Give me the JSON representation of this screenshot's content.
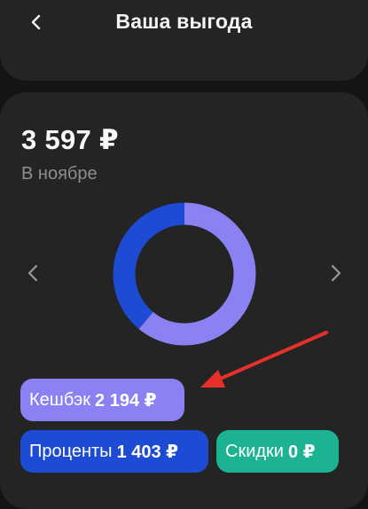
{
  "header": {
    "title": "Ваша выгода",
    "back_icon": "chevron-left-icon"
  },
  "summary": {
    "amount": "3 597 ₽",
    "period": "В ноябре"
  },
  "nav": {
    "prev_icon": "chevron-left-icon",
    "next_icon": "chevron-right-icon"
  },
  "chart_data": {
    "type": "pie",
    "categories": [
      "Кешбэк",
      "Проценты",
      "Скидки"
    ],
    "values": [
      2194,
      1403,
      0
    ],
    "colors": [
      "#8a82f3",
      "#1e4bd3",
      "#1cb393"
    ],
    "title": ""
  },
  "chips": [
    {
      "label": "Кешбэк",
      "value": "2 194 ₽",
      "color": "#8a82f3"
    },
    {
      "label": "Проценты",
      "value": "1 403 ₽",
      "color": "#1e4bd3"
    },
    {
      "label": "Скидки",
      "value": "0 ₽",
      "color": "#1cb393"
    }
  ],
  "annotation": {
    "arrow_color": "#e8302a"
  }
}
